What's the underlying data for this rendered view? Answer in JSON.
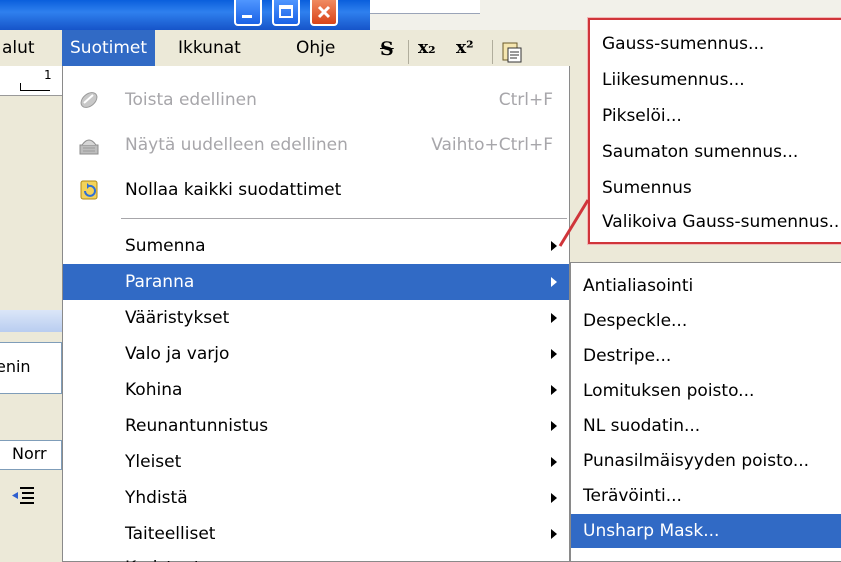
{
  "window": {
    "title_buttons": [
      "minimize-icon",
      "maximize-icon",
      "close-icon"
    ],
    "accent": "#316ac5",
    "titlebar_color": "#0a5fdc"
  },
  "menubar": {
    "items": [
      {
        "label": "alut",
        "active": false
      },
      {
        "label": "Suotimet",
        "active": true
      },
      {
        "label": "Ikkunat",
        "active": false
      },
      {
        "label": "Ohje",
        "active": false
      }
    ]
  },
  "toolbar": {
    "strike_glyph": "S",
    "subscript_glyph": "x₂",
    "superscript_glyph": "x²"
  },
  "ruler": {
    "number": "1"
  },
  "left_fragments": {
    "panel_text": "enin",
    "norm_text": "Norr"
  },
  "menu": {
    "items": [
      {
        "label": "Toista edellinen",
        "shortcut": "Ctrl+F",
        "disabled": true,
        "icon": "repeat-filter-icon"
      },
      {
        "label": "Näytä uudelleen edellinen",
        "shortcut": "Vaihto+Ctrl+F",
        "disabled": true,
        "icon": "reshow-filter-icon"
      },
      {
        "label": "Nollaa kaikki suodattimet",
        "shortcut": "",
        "disabled": false,
        "icon": "reset-filters-icon"
      },
      {
        "label": "Sumenna",
        "submenu": true
      },
      {
        "label": "Paranna",
        "submenu": true,
        "highlight": true
      },
      {
        "label": "Vääristykset",
        "submenu": true
      },
      {
        "label": "Valo ja varjo",
        "submenu": true
      },
      {
        "label": "Kohina",
        "submenu": true
      },
      {
        "label": "Reunantunnistus",
        "submenu": true
      },
      {
        "label": "Yleiset",
        "submenu": true
      },
      {
        "label": "Yhdistä",
        "submenu": true
      },
      {
        "label": "Taiteelliset",
        "submenu": true
      },
      {
        "label": "Koristeet",
        "submenu": true
      }
    ]
  },
  "submenu": {
    "items": [
      {
        "label": "Antialiasointi"
      },
      {
        "label": "Despeckle..."
      },
      {
        "label": "Destripe..."
      },
      {
        "label": "Lomituksen poisto..."
      },
      {
        "label": "NL suodatin..."
      },
      {
        "label": "Punasilmäisyyden poisto..."
      },
      {
        "label": "Terävöinti..."
      },
      {
        "label": "Unsharp Mask...",
        "highlight": true
      }
    ]
  },
  "callout": {
    "border_color": "#d0353a",
    "items": [
      {
        "label": "Gauss-sumennus..."
      },
      {
        "label": "Liikesumennus..."
      },
      {
        "label": "Pikselöi..."
      },
      {
        "label": "Saumaton sumennus..."
      },
      {
        "label": "Sumennus"
      },
      {
        "label": "Valikoiva Gauss-sumennus..."
      }
    ]
  }
}
